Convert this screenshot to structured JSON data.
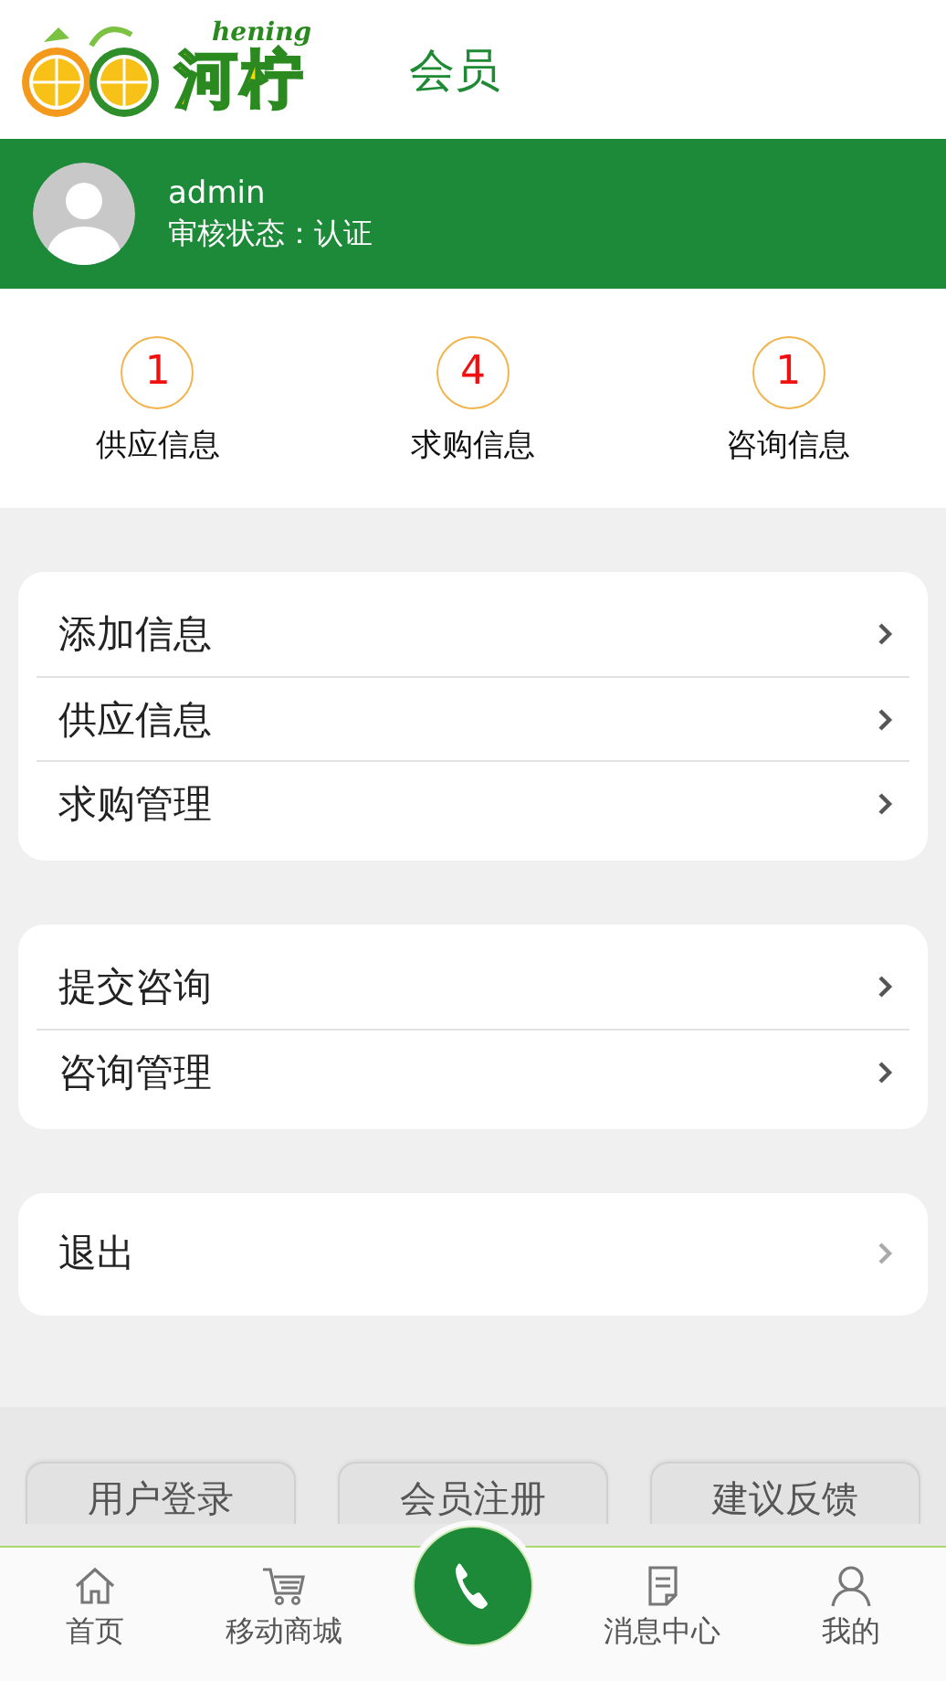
{
  "header": {
    "logo_latin": "hening",
    "logo_name": "河柠",
    "title": "会员"
  },
  "user": {
    "name": "admin",
    "status": "审核状态：认证"
  },
  "stats": [
    {
      "count": "1",
      "label": "供应信息"
    },
    {
      "count": "4",
      "label": "求购信息"
    },
    {
      "count": "1",
      "label": "咨询信息"
    }
  ],
  "menu_groups": [
    {
      "items": [
        "添加信息",
        "供应信息",
        "求购管理"
      ]
    },
    {
      "items": [
        "提交咨询",
        "咨询管理"
      ]
    },
    {
      "items": [
        "退出"
      ]
    }
  ],
  "footer_buttons": [
    "用户登录",
    "会员注册",
    "建议反馈"
  ],
  "bottom_nav": [
    {
      "kind": "home",
      "label": "首页"
    },
    {
      "kind": "cart",
      "label": "移动商城"
    },
    {
      "kind": "call"
    },
    {
      "kind": "note",
      "label": "消息中心"
    },
    {
      "kind": "person",
      "label": "我的"
    }
  ]
}
